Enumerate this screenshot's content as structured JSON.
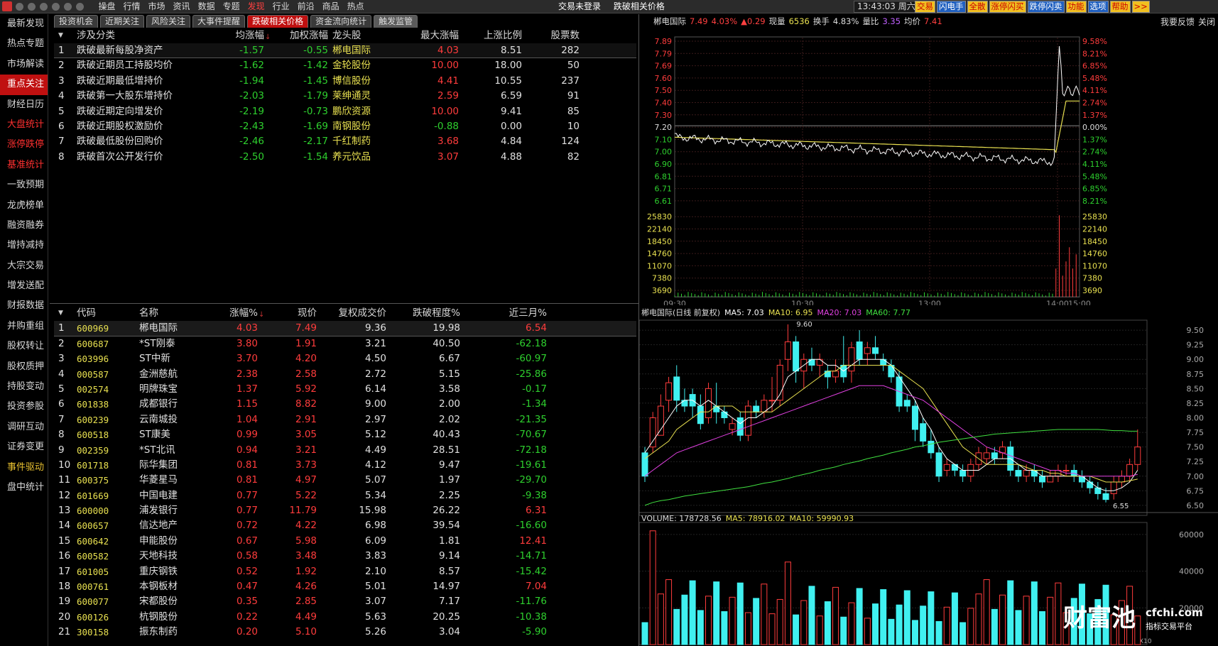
{
  "app": {
    "icon": "app-logo-icon",
    "menu": [
      "操盘",
      "行情",
      "市场",
      "资讯",
      "数据",
      "专题",
      "发现",
      "行业",
      "前沿",
      "商品",
      "热点"
    ],
    "active_menu": "发现",
    "login_status": "交易未登录",
    "window_title": "跌破相关价格",
    "clock": "13:43:03",
    "weekday": "周六",
    "quick_buttons": [
      {
        "label": "交易",
        "style": "yellow"
      },
      {
        "label": "闪电手",
        "style": "blue"
      },
      {
        "label": "全散",
        "style": "yellow"
      },
      {
        "label": "涨停闪买",
        "style": "yellow"
      },
      {
        "label": "跌停闪卖",
        "style": "blue"
      },
      {
        "label": "功能",
        "style": "yellow"
      },
      {
        "label": "选项",
        "style": "blue"
      },
      {
        "label": "帮助",
        "style": "yellow"
      },
      {
        "label": ">>",
        "style": "yellow"
      }
    ],
    "feedback": "我要反馈",
    "close": "关闭"
  },
  "sidebar": [
    {
      "label": "最新发现",
      "style": "normal"
    },
    {
      "label": "热点专题",
      "style": "normal"
    },
    {
      "label": "市场解读",
      "style": "normal"
    },
    {
      "label": "重点关注",
      "style": "active"
    },
    {
      "label": "财经日历",
      "style": "normal"
    },
    {
      "label": "大盘统计",
      "style": "red"
    },
    {
      "label": "涨停跌停",
      "style": "red"
    },
    {
      "label": "基准统计",
      "style": "red"
    },
    {
      "label": "一致预期",
      "style": "normal"
    },
    {
      "label": "龙虎榜单",
      "style": "normal"
    },
    {
      "label": "融资融券",
      "style": "normal"
    },
    {
      "label": "增持减持",
      "style": "normal"
    },
    {
      "label": "大宗交易",
      "style": "normal"
    },
    {
      "label": "增发送配",
      "style": "normal"
    },
    {
      "label": "财报数据",
      "style": "normal"
    },
    {
      "label": "并购重组",
      "style": "normal"
    },
    {
      "label": "股权转让",
      "style": "normal"
    },
    {
      "label": "股权质押",
      "style": "normal"
    },
    {
      "label": "持股变动",
      "style": "normal"
    },
    {
      "label": "投资参股",
      "style": "normal"
    },
    {
      "label": "调研互动",
      "style": "normal"
    },
    {
      "label": "证券变更",
      "style": "normal"
    },
    {
      "label": "事件驱动",
      "style": "yellow"
    },
    {
      "label": "盘中统计",
      "style": "normal"
    }
  ],
  "tabs": [
    {
      "label": "投资机会",
      "style": "normal"
    },
    {
      "label": "近期关注",
      "style": "normal"
    },
    {
      "label": "风险关注",
      "style": "normal"
    },
    {
      "label": "大事件提醒",
      "style": "normal"
    },
    {
      "label": "跌破相关价格",
      "style": "active"
    },
    {
      "label": "资金流向统计",
      "style": "normal"
    },
    {
      "label": "触发监管",
      "style": "gray"
    }
  ],
  "category_table": {
    "headers": [
      "涉及分类",
      "均涨幅",
      "加权涨幅",
      "龙头股",
      "最大涨幅",
      "上涨比例",
      "股票数"
    ],
    "sort_marker": "↓",
    "rows": [
      [
        "1",
        "跌破最新每股净资产",
        "-1.57",
        "-0.55",
        "郴电国际",
        "4.03",
        "8.51",
        "282"
      ],
      [
        "2",
        "跌破近期员工持股均价",
        "-1.62",
        "-1.42",
        "金轮股份",
        "10.00",
        "18.00",
        "50"
      ],
      [
        "3",
        "跌破近期最低增持价",
        "-1.94",
        "-1.45",
        "博信股份",
        "4.41",
        "10.55",
        "237"
      ],
      [
        "4",
        "跌破第一大股东增持价",
        "-2.03",
        "-1.79",
        "莱绅通灵",
        "2.59",
        "6.59",
        "91"
      ],
      [
        "5",
        "跌破近期定向增发价",
        "-2.19",
        "-0.73",
        "鹏欣资源",
        "10.00",
        "9.41",
        "85"
      ],
      [
        "6",
        "跌破近期股权激励价",
        "-2.43",
        "-1.69",
        "南钢股份",
        "-0.88",
        "0.00",
        "10"
      ],
      [
        "7",
        "跌破最低股份回购价",
        "-2.46",
        "-2.17",
        "千红制药",
        "3.68",
        "4.84",
        "124"
      ],
      [
        "8",
        "跌破首次公开发行价",
        "-2.50",
        "-1.54",
        "养元饮品",
        "3.07",
        "4.88",
        "82"
      ]
    ]
  },
  "stock_table": {
    "headers": [
      "代码",
      "名称",
      "涨幅%",
      "现价",
      "复权成交价",
      "跌破程度%",
      "近三月%"
    ],
    "sort_marker": "↓",
    "rows": [
      [
        "1",
        "600969",
        "郴电国际",
        "4.03",
        "7.49",
        "9.36",
        "19.98",
        "6.54"
      ],
      [
        "2",
        "600687",
        "*ST刚泰",
        "3.80",
        "1.91",
        "3.21",
        "40.50",
        "-62.18"
      ],
      [
        "3",
        "603996",
        "ST中新",
        "3.70",
        "4.20",
        "4.50",
        "6.67",
        "-60.97"
      ],
      [
        "4",
        "000587",
        "金洲慈航",
        "2.38",
        "2.58",
        "2.72",
        "5.15",
        "-25.86"
      ],
      [
        "5",
        "002574",
        "明牌珠宝",
        "1.37",
        "5.92",
        "6.14",
        "3.58",
        "-0.17"
      ],
      [
        "6",
        "601838",
        "成都银行",
        "1.15",
        "8.82",
        "9.00",
        "2.00",
        "-1.34"
      ],
      [
        "7",
        "600239",
        "云南城投",
        "1.04",
        "2.91",
        "2.97",
        "2.02",
        "-21.35"
      ],
      [
        "8",
        "600518",
        "ST康美",
        "0.99",
        "3.05",
        "5.12",
        "40.43",
        "-70.67"
      ],
      [
        "9",
        "002359",
        "*ST北讯",
        "0.94",
        "3.21",
        "4.49",
        "28.51",
        "-72.18"
      ],
      [
        "10",
        "601718",
        "际华集团",
        "0.81",
        "3.73",
        "4.12",
        "9.47",
        "-19.61"
      ],
      [
        "11",
        "600375",
        "华菱星马",
        "0.81",
        "4.97",
        "5.07",
        "1.97",
        "-29.70"
      ],
      [
        "12",
        "601669",
        "中国电建",
        "0.77",
        "5.22",
        "5.34",
        "2.25",
        "-9.38"
      ],
      [
        "13",
        "600000",
        "浦发银行",
        "0.77",
        "11.79",
        "15.98",
        "26.22",
        "6.31"
      ],
      [
        "14",
        "600657",
        "信达地产",
        "0.72",
        "4.22",
        "6.98",
        "39.54",
        "-16.60"
      ],
      [
        "15",
        "600642",
        "申能股份",
        "0.67",
        "5.98",
        "6.09",
        "1.81",
        "12.41"
      ],
      [
        "16",
        "600582",
        "天地科技",
        "0.58",
        "3.48",
        "3.83",
        "9.14",
        "-14.71"
      ],
      [
        "17",
        "601005",
        "重庆钢铁",
        "0.52",
        "1.92",
        "2.10",
        "8.57",
        "-15.42"
      ],
      [
        "18",
        "000761",
        "本钢板材",
        "0.47",
        "4.26",
        "5.01",
        "14.97",
        "7.04"
      ],
      [
        "19",
        "600077",
        "宋都股份",
        "0.35",
        "2.85",
        "3.07",
        "7.17",
        "-11.76"
      ],
      [
        "20",
        "600126",
        "杭钢股份",
        "0.22",
        "4.49",
        "5.63",
        "20.25",
        "-10.38"
      ],
      [
        "21",
        "300158",
        "振东制药",
        "0.20",
        "5.10",
        "5.26",
        "3.04",
        "-5.90"
      ]
    ]
  },
  "intraday": {
    "name": "郴电国际",
    "price": "7.49",
    "pct": "4.03%",
    "change": "▲0.29",
    "vol_label": "现量",
    "vol": "6536",
    "turnover_label": "换手",
    "turnover": "4.83%",
    "ratio_label": "量比",
    "ratio": "3.35",
    "avg_label": "均价",
    "avg": "7.41",
    "price_ticks": [
      "7.89",
      "7.79",
      "7.69",
      "7.60",
      "7.50",
      "7.40",
      "7.30",
      "7.20",
      "7.10",
      "7.00",
      "6.90",
      "6.81",
      "6.71",
      "6.61"
    ],
    "pct_ticks": [
      "9.58%",
      "8.21%",
      "6.85%",
      "5.48%",
      "4.11%",
      "2.74%",
      "1.37%",
      "0.00%",
      "1.37%",
      "2.74%",
      "4.11%",
      "5.48%",
      "6.85%",
      "8.21%"
    ],
    "vol_ticks": [
      "25830",
      "22140",
      "18450",
      "14760",
      "11070",
      "7380",
      "3690"
    ],
    "time_ticks": [
      "09:30",
      "10:30",
      "13:00",
      "14:00",
      "15:00"
    ],
    "prev_close": 7.2
  },
  "daily": {
    "title": "郴电国际(日线 前复权)",
    "ma5": "MA5: 7.03",
    "ma10": "MA10: 6.95",
    "ma20": "MA20: 7.03",
    "ma60": "MA60: 7.77",
    "high_mark": "9.60",
    "low_mark": "6.55",
    "price_ticks": [
      "9.50",
      "9.25",
      "9.00",
      "8.75",
      "8.50",
      "8.25",
      "8.00",
      "7.75",
      "7.50",
      "7.25",
      "7.00",
      "6.75",
      "6.50"
    ],
    "vol_title": "VOLUME: 178728.56",
    "vol_ma5": "MA5: 78916.02",
    "vol_ma10": "MA10: 59990.93",
    "vol_ticks": [
      "60000",
      "40000",
      "20000"
    ],
    "vol_unit": "X10",
    "ohlc": [
      [
        7.4,
        7.5,
        6.9,
        7.0
      ],
      [
        7.5,
        8.1,
        7.4,
        8.0
      ],
      [
        7.7,
        8.4,
        7.7,
        8.2
      ],
      [
        8.3,
        8.7,
        8.1,
        8.6
      ],
      [
        8.7,
        8.9,
        8.1,
        8.3
      ],
      [
        8.3,
        8.5,
        8.1,
        8.2
      ],
      [
        8.4,
        8.5,
        8.0,
        8.2
      ],
      [
        8.2,
        8.4,
        7.8,
        7.9
      ],
      [
        8.0,
        8.6,
        7.9,
        8.5
      ],
      [
        8.2,
        8.6,
        7.9,
        8.1
      ],
      [
        8.1,
        8.2,
        7.9,
        8.0
      ],
      [
        7.8,
        8.0,
        7.7,
        7.9
      ],
      [
        8.0,
        8.1,
        7.6,
        7.7
      ],
      [
        7.7,
        8.3,
        7.6,
        8.2
      ],
      [
        8.2,
        8.3,
        8.0,
        8.1
      ],
      [
        8.1,
        8.4,
        8.0,
        8.3
      ],
      [
        8.3,
        8.7,
        8.1,
        8.3
      ],
      [
        8.3,
        9.0,
        8.2,
        8.9
      ],
      [
        9.0,
        9.6,
        8.8,
        9.3
      ],
      [
        9.3,
        9.4,
        8.6,
        8.8
      ],
      [
        8.8,
        9.1,
        8.5,
        9.0
      ],
      [
        9.0,
        9.2,
        8.8,
        8.9
      ],
      [
        8.9,
        9.1,
        8.7,
        9.0
      ],
      [
        8.8,
        8.9,
        8.5,
        8.7
      ],
      [
        8.7,
        9.0,
        8.6,
        8.8
      ],
      [
        8.9,
        9.4,
        8.6,
        8.7
      ],
      [
        8.8,
        9.3,
        8.6,
        9.2
      ],
      [
        9.3,
        9.5,
        8.9,
        9.0
      ],
      [
        9.1,
        9.3,
        8.9,
        9.2
      ],
      [
        9.2,
        9.4,
        9.0,
        9.1
      ],
      [
        9.0,
        9.1,
        8.8,
        8.9
      ],
      [
        8.9,
        9.0,
        8.6,
        8.7
      ],
      [
        8.7,
        8.8,
        8.1,
        8.2
      ],
      [
        8.3,
        8.4,
        8.1,
        8.2
      ],
      [
        8.2,
        8.3,
        7.6,
        7.8
      ],
      [
        7.9,
        8.0,
        7.5,
        7.6
      ],
      [
        7.6,
        7.8,
        7.3,
        7.4
      ],
      [
        7.4,
        7.5,
        6.9,
        7.0
      ],
      [
        7.1,
        7.3,
        7.0,
        7.2
      ],
      [
        7.2,
        7.2,
        7.0,
        7.1
      ],
      [
        7.1,
        7.2,
        6.9,
        7.0
      ],
      [
        7.0,
        7.3,
        6.9,
        7.2
      ],
      [
        7.2,
        7.5,
        7.1,
        7.4
      ],
      [
        7.3,
        7.5,
        7.2,
        7.4
      ],
      [
        7.4,
        7.5,
        7.2,
        7.3
      ],
      [
        7.4,
        7.6,
        7.3,
        7.5
      ],
      [
        7.5,
        7.6,
        7.0,
        7.1
      ],
      [
        7.1,
        7.2,
        6.9,
        7.0
      ],
      [
        7.0,
        7.2,
        6.9,
        7.1
      ],
      [
        7.1,
        7.2,
        6.9,
        7.0
      ],
      [
        7.0,
        7.1,
        6.8,
        6.9
      ],
      [
        6.9,
        7.1,
        6.9,
        7.0
      ],
      [
        7.0,
        7.2,
        6.9,
        7.1
      ],
      [
        7.1,
        7.2,
        7.0,
        7.1
      ],
      [
        7.1,
        7.2,
        6.9,
        7.0
      ],
      [
        7.0,
        7.1,
        6.8,
        6.9
      ],
      [
        6.9,
        7.0,
        6.7,
        6.8
      ],
      [
        6.8,
        6.9,
        6.6,
        6.7
      ],
      [
        6.7,
        6.8,
        6.55,
        6.6
      ],
      [
        6.7,
        7.0,
        6.6,
        6.9
      ],
      [
        6.9,
        7.1,
        6.8,
        7.0
      ],
      [
        7.0,
        7.3,
        6.9,
        7.2
      ],
      [
        7.2,
        7.8,
        7.1,
        7.5
      ]
    ],
    "ma_lines": {
      "MA5": [
        7.4,
        7.6,
        7.8,
        8.0,
        8.2,
        8.3,
        8.3,
        8.2,
        8.3,
        8.2,
        8.1,
        8.0,
        7.9,
        8.0,
        8.0,
        8.1,
        8.2,
        8.4,
        8.7,
        8.8,
        8.9,
        9.0,
        9.0,
        8.9,
        8.9,
        8.8,
        8.9,
        9.0,
        9.0,
        9.0,
        9.0,
        8.9,
        8.7,
        8.5,
        8.3,
        8.0,
        7.8,
        7.5,
        7.3,
        7.2,
        7.1,
        7.1,
        7.1,
        7.2,
        7.3,
        7.3,
        7.3,
        7.2,
        7.1,
        7.1,
        7.0,
        7.0,
        7.0,
        7.0,
        7.0,
        7.0,
        6.9,
        6.8,
        6.75,
        6.75,
        6.8,
        6.9,
        7.1
      ],
      "MA10": [
        7.3,
        7.4,
        7.5,
        7.6,
        7.8,
        7.9,
        8.0,
        8.1,
        8.1,
        8.2,
        8.2,
        8.2,
        8.1,
        8.1,
        8.1,
        8.1,
        8.1,
        8.2,
        8.3,
        8.4,
        8.5,
        8.6,
        8.7,
        8.8,
        8.8,
        8.9,
        8.9,
        8.9,
        8.9,
        8.9,
        8.9,
        8.9,
        8.8,
        8.7,
        8.6,
        8.5,
        8.3,
        8.1,
        7.9,
        7.7,
        7.5,
        7.4,
        7.3,
        7.2,
        7.2,
        7.2,
        7.2,
        7.2,
        7.15,
        7.1,
        7.1,
        7.05,
        7.05,
        7.0,
        7.0,
        7.0,
        7.0,
        6.95,
        6.9,
        6.9,
        6.9,
        6.92,
        6.95
      ],
      "MA20": [
        7.0,
        7.1,
        7.2,
        7.3,
        7.4,
        7.45,
        7.5,
        7.55,
        7.6,
        7.65,
        7.7,
        7.75,
        7.8,
        7.85,
        7.9,
        7.95,
        8.0,
        8.05,
        8.1,
        8.15,
        8.2,
        8.25,
        8.3,
        8.35,
        8.4,
        8.45,
        8.5,
        8.55,
        8.55,
        8.55,
        8.55,
        8.5,
        8.45,
        8.4,
        8.35,
        8.3,
        8.2,
        8.1,
        8.0,
        7.9,
        7.8,
        7.7,
        7.6,
        7.5,
        7.45,
        7.4,
        7.35,
        7.3,
        7.25,
        7.2,
        7.15,
        7.1,
        7.1,
        7.05,
        7.05,
        7.0,
        7.0,
        7.0,
        7.0,
        7.0,
        7.0,
        7.0,
        7.03
      ],
      "MA60": [
        6.5,
        6.55,
        6.58,
        6.6,
        6.63,
        6.66,
        6.68,
        6.7,
        6.72,
        6.74,
        6.76,
        6.78,
        6.8,
        6.82,
        6.85,
        6.88,
        6.9,
        6.93,
        6.96,
        7.0,
        7.03,
        7.06,
        7.1,
        7.13,
        7.16,
        7.2,
        7.23,
        7.26,
        7.3,
        7.33,
        7.36,
        7.4,
        7.43,
        7.46,
        7.5,
        7.52,
        7.55,
        7.58,
        7.6,
        7.62,
        7.64,
        7.66,
        7.68,
        7.7,
        7.72,
        7.73,
        7.74,
        7.75,
        7.76,
        7.77,
        7.78,
        7.79,
        7.8,
        7.8,
        7.8,
        7.8,
        7.8,
        7.8,
        7.79,
        7.78,
        7.78,
        7.77,
        7.77
      ]
    }
  },
  "watermark": {
    "brand": "财富池",
    "site": "cfchi.com",
    "slogan": "指标交易平台"
  }
}
